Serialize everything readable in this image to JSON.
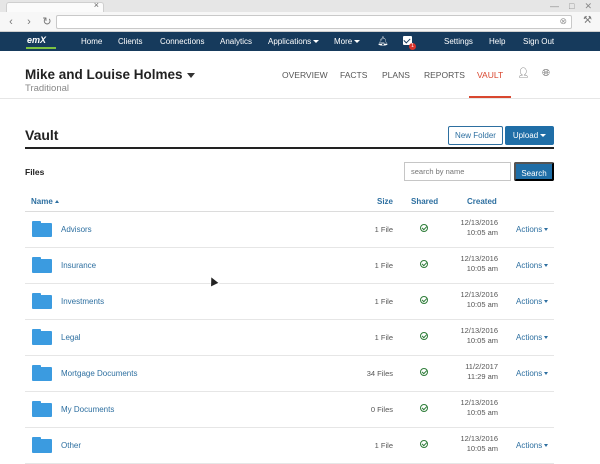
{
  "nav": {
    "logo": "emX",
    "items": [
      "Home",
      "Clients",
      "Connections",
      "Analytics",
      "Applications",
      "More",
      "Settings",
      "Help",
      "Sign Out"
    ],
    "badge": "1"
  },
  "client": {
    "name": "Mike and Louise Holmes",
    "type": "Traditional",
    "tabs": [
      "OVERVIEW",
      "FACTS",
      "PLANS",
      "REPORTS",
      "VAULT"
    ]
  },
  "vault": {
    "title": "Vault",
    "new_folder": "New Folder",
    "upload": "Upload",
    "files_label": "Files",
    "search_placeholder": "search by name",
    "search_button": "Search"
  },
  "table": {
    "headers": {
      "name": "Name",
      "size": "Size",
      "shared": "Shared",
      "created": "Created"
    },
    "rows": [
      {
        "name": "Advisors",
        "size": "1 File",
        "date": "12/13/2016",
        "time": "10:05 am",
        "actions": "Actions"
      },
      {
        "name": "Insurance",
        "size": "1 File",
        "date": "12/13/2016",
        "time": "10:05 am",
        "actions": "Actions"
      },
      {
        "name": "Investments",
        "size": "1 File",
        "date": "12/13/2016",
        "time": "10:05 am",
        "actions": "Actions"
      },
      {
        "name": "Legal",
        "size": "1 File",
        "date": "12/13/2016",
        "time": "10:05 am",
        "actions": "Actions"
      },
      {
        "name": "Mortgage Documents",
        "size": "34 Files",
        "date": "11/2/2017",
        "time": "11:29 am",
        "actions": "Actions"
      },
      {
        "name": "My Documents",
        "size": "0 Files",
        "date": "12/13/2016",
        "time": "10:05 am",
        "actions": ""
      },
      {
        "name": "Other",
        "size": "1 File",
        "date": "12/13/2016",
        "time": "10:05 am",
        "actions": "Actions"
      }
    ]
  },
  "colors": {
    "nav_bg": "#163a5c",
    "accent": "#1f6ea7",
    "link": "#2d6fa0",
    "active_tab": "#d9472f",
    "folder": "#3b9be0",
    "shared_check": "#2f7d3a"
  }
}
